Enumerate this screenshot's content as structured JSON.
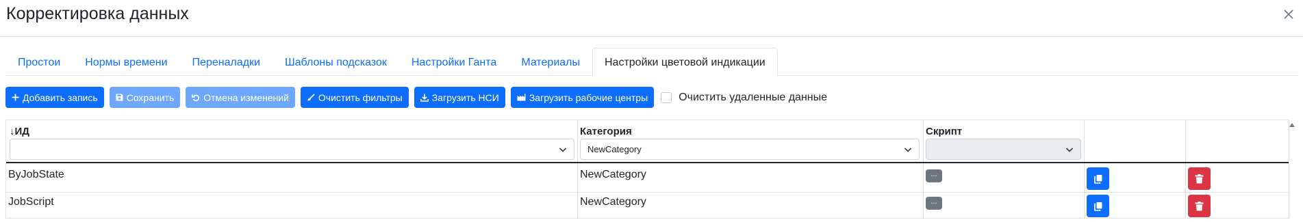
{
  "dialog": {
    "title": "Корректировка данных",
    "close_icon": "close-icon"
  },
  "tabs": [
    {
      "label": "Простои",
      "active": false
    },
    {
      "label": "Нормы времени",
      "active": false
    },
    {
      "label": "Переналадки",
      "active": false
    },
    {
      "label": "Шаблоны подсказок",
      "active": false
    },
    {
      "label": "Настройки Ганта",
      "active": false
    },
    {
      "label": "Материалы",
      "active": false
    },
    {
      "label": "Настройки цветовой индикации",
      "active": true
    }
  ],
  "toolbar": {
    "add_label": "Добавить запись",
    "save_label": "Сохранить",
    "cancel_label": "Отмена изменений",
    "clear_filters_label": "Очистить фильтры",
    "load_nsi_label": "Загрузить НСИ",
    "load_workcenters_label": "Загрузить рабочие центры",
    "clear_deleted_label": "Очистить удаленные данные",
    "clear_deleted_checked": false
  },
  "grid": {
    "columns": {
      "id": {
        "label": "↓ИД",
        "filter_value": ""
      },
      "category": {
        "label": "Категория",
        "filter_value": "NewCategory"
      },
      "script": {
        "label": "Скрипт",
        "filter_value": ""
      }
    },
    "rows": [
      {
        "id": "ByJobState",
        "category": "NewCategory",
        "script_button": "..."
      },
      {
        "id": "JobScript",
        "category": "NewCategory",
        "script_button": "..."
      }
    ]
  },
  "colors": {
    "primary": "#0d6efd",
    "primary_disabled": "#6ea8fe",
    "danger": "#dc3545",
    "secondary": "#6c757d"
  }
}
